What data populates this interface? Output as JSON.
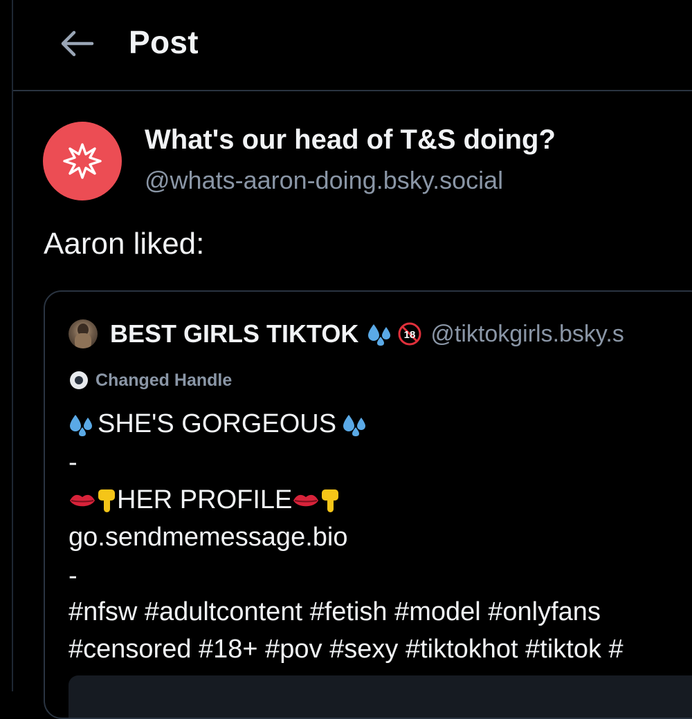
{
  "header": {
    "title": "Post"
  },
  "post": {
    "author_name": "What's our head of T&S doing?",
    "author_handle": "@whats-aaron-doing.bsky.social",
    "text": "Aaron liked:"
  },
  "quoted_post": {
    "author_name": "BEST GIRLS TIKTOK",
    "author_handle": "@tiktokgirls.bsky.s",
    "label": "Changed Handle",
    "line1": "SHE'S GORGEOUS",
    "line2": "-",
    "line3": "HER PROFILE",
    "line4": "go.sendmemessage.bio",
    "line5": "-",
    "line6": "#nfsw #adultcontent #fetish #model #onlyfans",
    "line7": "#censored #18+ #pov #sexy #tiktokhot #tiktok #",
    "badge_18": "18"
  },
  "icons": {
    "back": "arrow-left-icon",
    "avatar": "starburst-icon",
    "sweat": "sweat-droplets-icon",
    "lips": "lips-icon",
    "pointing": "pointing-down-icon",
    "label": "circle-alert-icon"
  },
  "colors": {
    "background": "#000000",
    "avatar_bg": "#ec4d54",
    "text_primary": "#f1f3f5",
    "text_secondary": "#8a96a6",
    "border": "#2a3441",
    "droplets": "#5aa9e6",
    "lips": "#d8233a",
    "hand": "#f5c518"
  }
}
